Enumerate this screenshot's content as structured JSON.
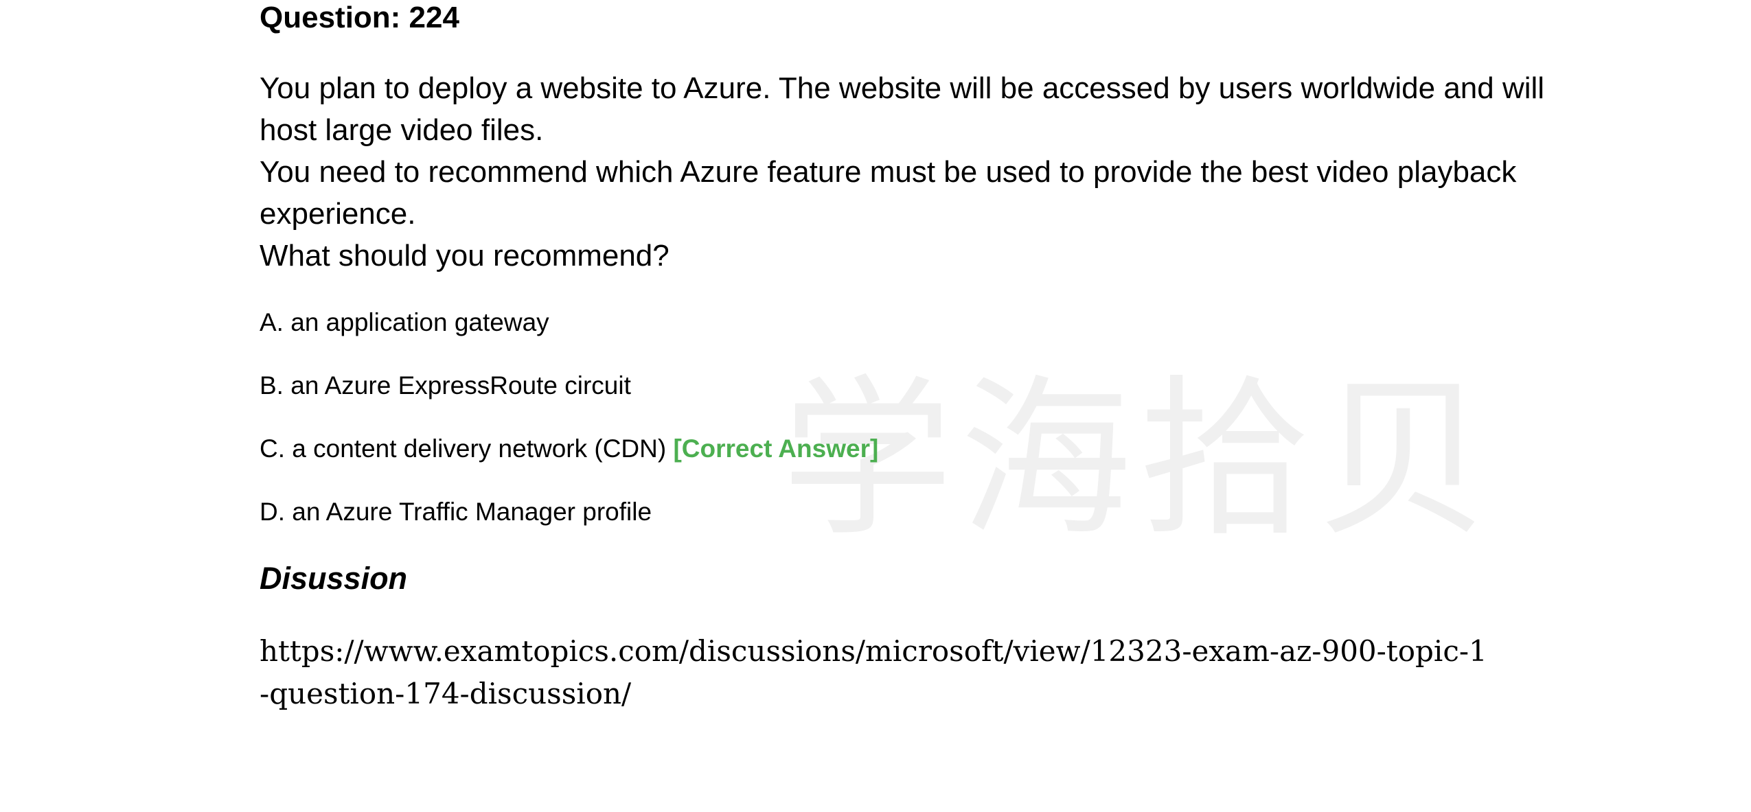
{
  "question": {
    "title": "Question: 224",
    "stem": [
      "You plan to deploy a website to Azure. The website will be accessed by users worldwide and will host large video files.",
      "You need to recommend which Azure feature must be used to provide the best video playback experience.",
      "What should you recommend?"
    ],
    "options": [
      {
        "label": "A. an application gateway"
      },
      {
        "label": "B. an Azure ExpressRoute circuit"
      },
      {
        "label": "C. a content delivery network (CDN)",
        "badge": "[Correct Answer]"
      },
      {
        "label": "D. an Azure Traffic Manager profile"
      }
    ]
  },
  "discussion": {
    "title": "Disussion",
    "url": "https://www.examtopics.com/discussions/microsoft/view/12323-exam-az-900-topic-1-question-174-discussion/"
  },
  "watermark": {
    "text": "学海拾贝"
  },
  "colors": {
    "correct_answer": "#4caf50",
    "watermark": "#f0f0f0",
    "text": "#000000"
  }
}
